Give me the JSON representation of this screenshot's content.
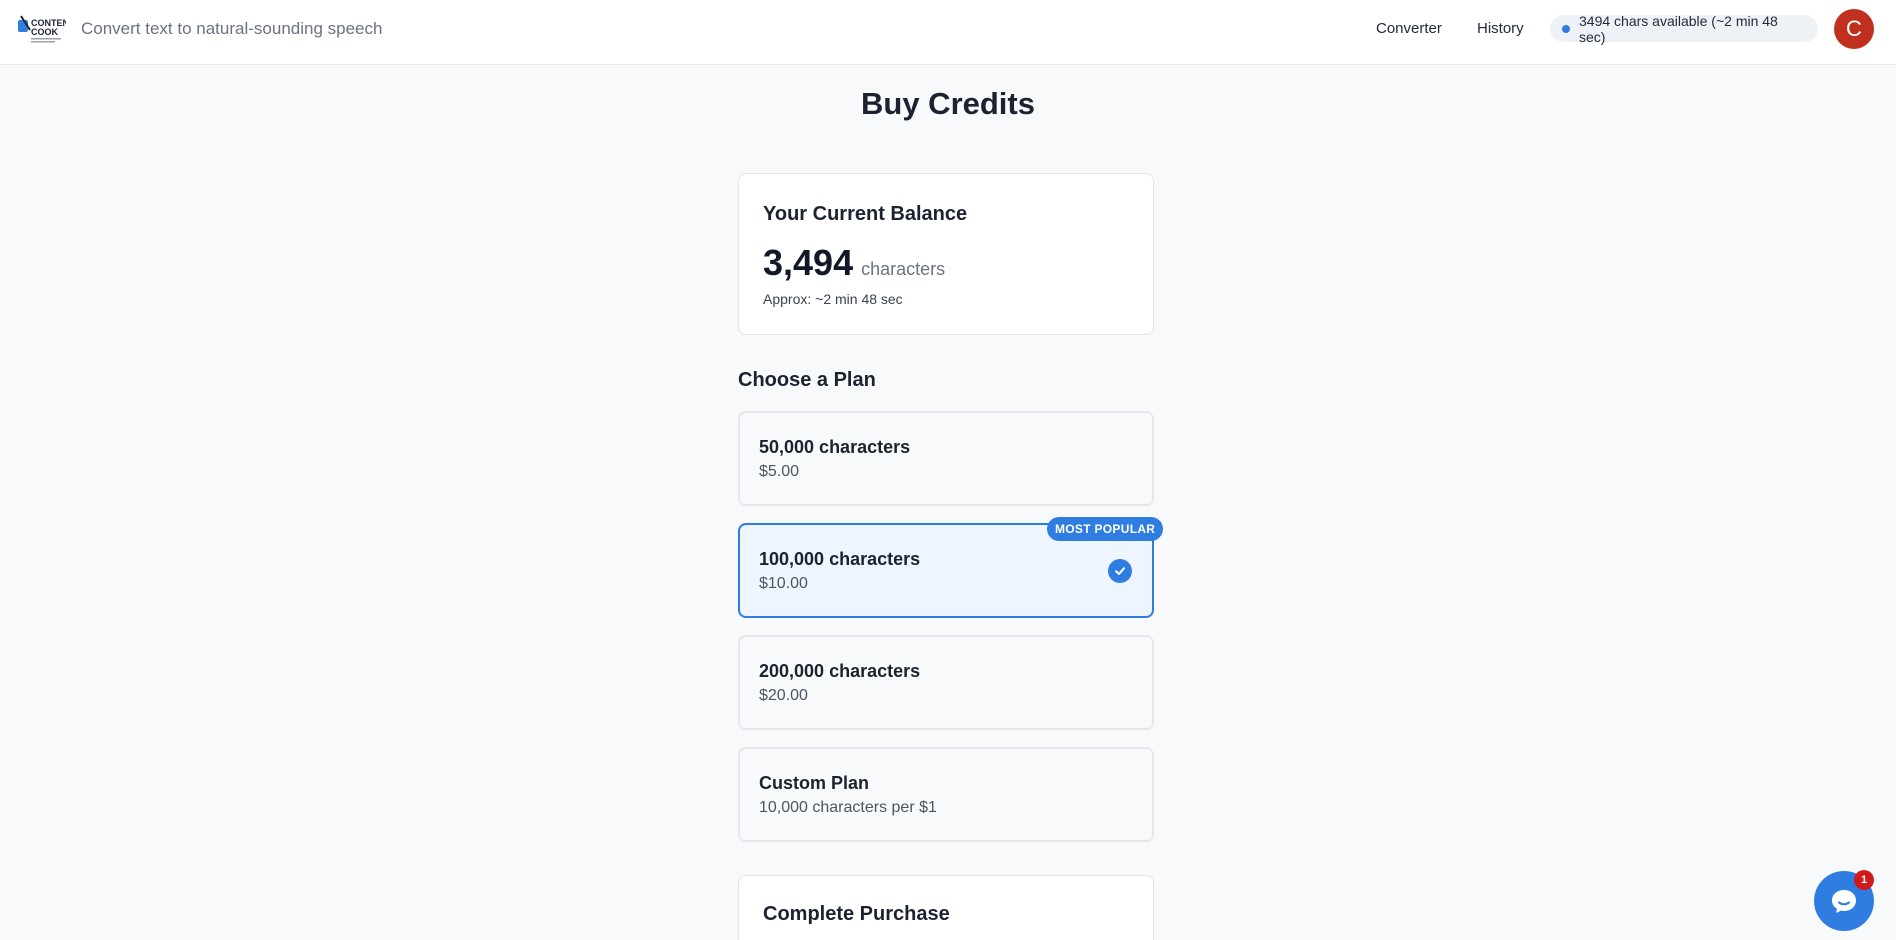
{
  "header": {
    "logo_text_line1": "CONTENT",
    "logo_text_line2": "COOK",
    "tagline": "Convert text to natural-sounding speech",
    "nav": [
      {
        "label": "Converter"
      },
      {
        "label": "History"
      }
    ],
    "credits_status": "3494 chars available (~2 min 48 sec)",
    "avatar_initial": "C"
  },
  "page": {
    "title": "Buy Credits"
  },
  "balance": {
    "heading": "Your Current Balance",
    "value": "3,494",
    "unit": "characters",
    "approx": "Approx: ~2 min 48 sec"
  },
  "plans": {
    "heading": "Choose a Plan",
    "badge": "MOST POPULAR",
    "items": [
      {
        "name": "50,000 characters",
        "price": "$5.00",
        "selected": false
      },
      {
        "name": "100,000 characters",
        "price": "$10.00",
        "selected": true
      },
      {
        "name": "200,000 characters",
        "price": "$20.00",
        "selected": false
      },
      {
        "name": "Custom Plan",
        "price": "10,000 characters per $1",
        "selected": false
      }
    ]
  },
  "purchase": {
    "heading": "Complete Purchase"
  },
  "chat": {
    "unread_count": "1",
    "icon": "chat-bubble-icon"
  },
  "colors": {
    "accent": "#2f7de0",
    "avatar": "#c0301e",
    "notification": "#d11a1a"
  }
}
